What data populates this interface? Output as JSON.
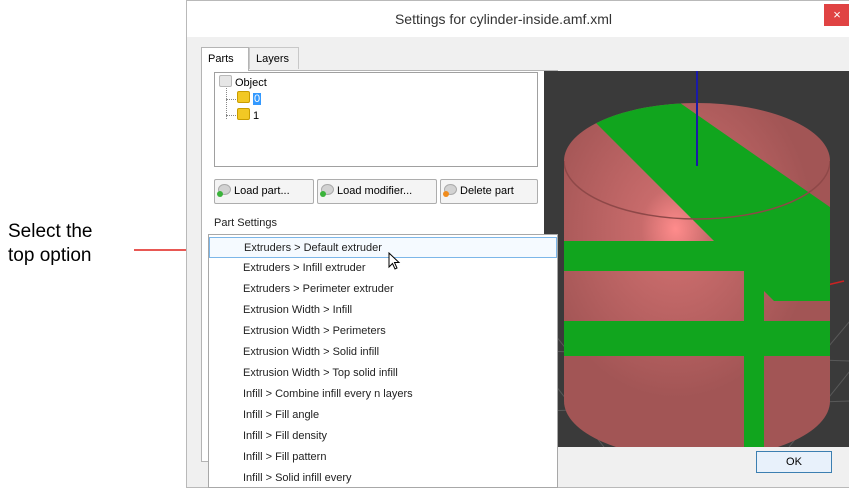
{
  "annotation": {
    "line1": "Select the",
    "line2": "top option",
    "arrow_color": "#e0201b"
  },
  "window": {
    "title": "Settings for cylinder-inside.amf.xml",
    "close_glyph": "×",
    "tabs": [
      {
        "label": "Parts",
        "active": true
      },
      {
        "label": "Layers",
        "active": false
      }
    ],
    "tree": {
      "root": "Object",
      "children": [
        "0",
        "1"
      ],
      "selected": "0"
    },
    "buttons": {
      "load_part": "Load part...",
      "load_modifier": "Load modifier...",
      "delete_part": "Delete part"
    },
    "part_settings_label": "Part Settings",
    "ok_label": "OK"
  },
  "dropdown": {
    "items": [
      "Extruders > Default extruder",
      "Extruders > Infill extruder",
      "Extruders > Perimeter extruder",
      "Extrusion Width > Infill",
      "Extrusion Width > Perimeters",
      "Extrusion Width > Solid infill",
      "Extrusion Width > Top solid infill",
      "Infill > Combine infill every n layers",
      "Infill > Fill angle",
      "Infill > Fill density",
      "Infill > Fill pattern",
      "Infill > Solid infill every"
    ],
    "highlighted": 0
  },
  "preview": {
    "body_color": "#b86060",
    "stripe_color": "#11a51e",
    "background": "#3a3a3a"
  },
  "colors": {
    "selection": "#3399ff",
    "close_button": "#e04343"
  }
}
